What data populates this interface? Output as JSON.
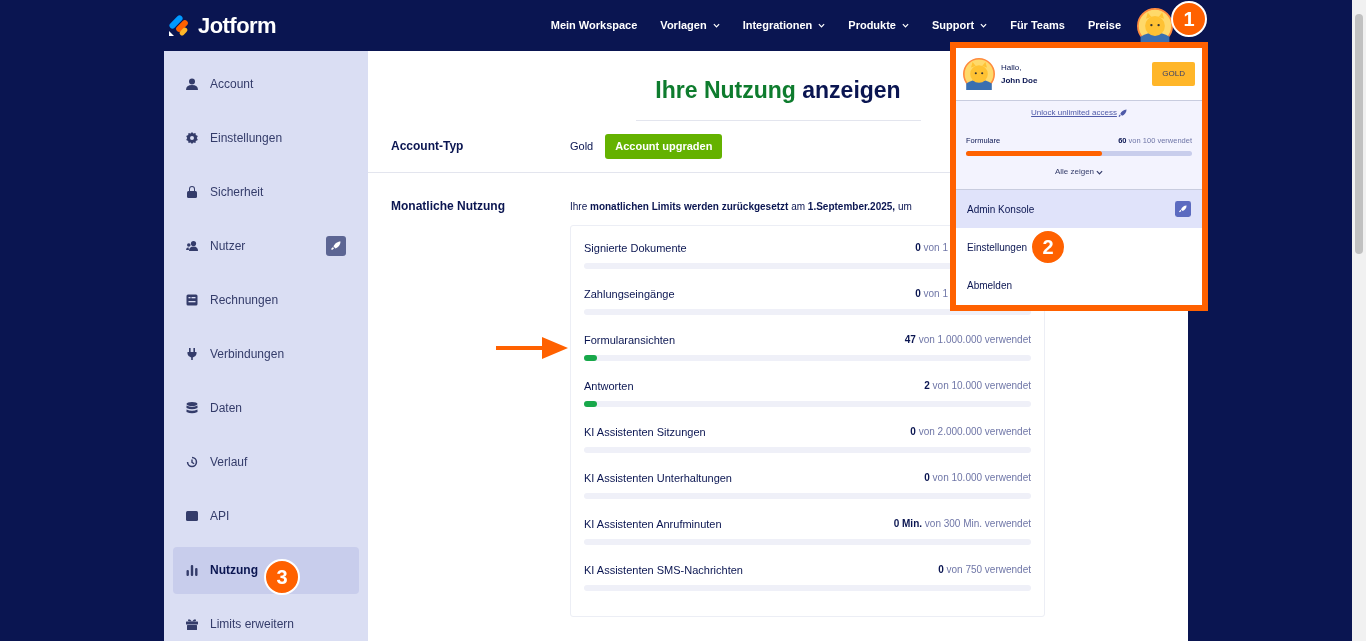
{
  "brand": {
    "name": "Jotform"
  },
  "nav": [
    {
      "label": "Mein Workspace",
      "dropdown": false
    },
    {
      "label": "Vorlagen",
      "dropdown": true
    },
    {
      "label": "Integrationen",
      "dropdown": true
    },
    {
      "label": "Produkte",
      "dropdown": true
    },
    {
      "label": "Support",
      "dropdown": true
    },
    {
      "label": "Für Teams",
      "dropdown": false
    },
    {
      "label": "Preise",
      "dropdown": false
    }
  ],
  "sidebar": {
    "items": [
      {
        "label": "Account",
        "selected": false,
        "badge": false
      },
      {
        "label": "Einstellungen",
        "selected": false,
        "badge": false
      },
      {
        "label": "Sicherheit",
        "selected": false,
        "badge": false
      },
      {
        "label": "Nutzer",
        "selected": false,
        "badge": true
      },
      {
        "label": "Rechnungen",
        "selected": false,
        "badge": false
      },
      {
        "label": "Verbindungen",
        "selected": false,
        "badge": false
      },
      {
        "label": "Daten",
        "selected": false,
        "badge": false
      },
      {
        "label": "Verlauf",
        "selected": false,
        "badge": false
      },
      {
        "label": "API",
        "selected": false,
        "badge": false
      },
      {
        "label": "Nutzung",
        "selected": true,
        "badge": false
      },
      {
        "label": "Limits erweitern",
        "selected": false,
        "badge": false
      }
    ]
  },
  "main": {
    "title": {
      "highlight": "Ihre Nutzung",
      "rest": "anzeigen"
    },
    "account_type": {
      "label": "Account-Typ",
      "value": "Gold",
      "button": "Account upgraden"
    },
    "monthly": {
      "label": "Monatliche Nutzung",
      "note": "Ihre **monatlichen Limits werden zurückgesetzt** am **1.September.2025,** um",
      "rows": [
        {
          "name": "Signierte Dokumente",
          "count": "0",
          "rest": "von 1",
          "level": 0
        },
        {
          "name": "Zahlungseingänge",
          "count": "0",
          "rest": "von 1",
          "level": 0
        },
        {
          "name": "Formularansichten",
          "count": "47",
          "rest": "von 1.000.000 verwendet",
          "level": 5e-05
        },
        {
          "name": "Antworten",
          "count": "2",
          "rest": "von 10.000 verwendet",
          "level": 0.0002
        },
        {
          "name": "KI Assistenten Sitzungen",
          "count": "0",
          "rest": "von 2.000.000 verwendet",
          "level": 0
        },
        {
          "name": "KI Assistenten Unterhaltungen",
          "count": "0",
          "rest": "von 10.000 verwendet",
          "level": 0
        },
        {
          "name": "KI Assistenten Anrufminuten",
          "count": "0 Min.",
          "rest": "von 300 Min. verwendet",
          "level": 0
        },
        {
          "name": "KI Assistenten SMS-Nachrichten",
          "count": "0",
          "rest": "von 750 verwendet",
          "level": 0
        }
      ]
    }
  },
  "user_menu": {
    "greeting": "Hallo,",
    "name": "John Doe",
    "plan": "GOLD",
    "link": "Unlock unlimited access",
    "usage": {
      "name": "Formulare",
      "count": "60",
      "rest": "von 100 verwendet",
      "level": 0.6
    },
    "show_all": "Alle zeigen",
    "items": [
      {
        "label": "Admin Konsole",
        "selected": true,
        "badge": true
      },
      {
        "label": "Einstellungen",
        "selected": false,
        "badge": false
      },
      {
        "label": "Abmelden",
        "selected": false,
        "badge": false
      }
    ]
  },
  "annotations": [
    {
      "label": "1"
    },
    {
      "label": "2"
    },
    {
      "label": "3"
    }
  ]
}
